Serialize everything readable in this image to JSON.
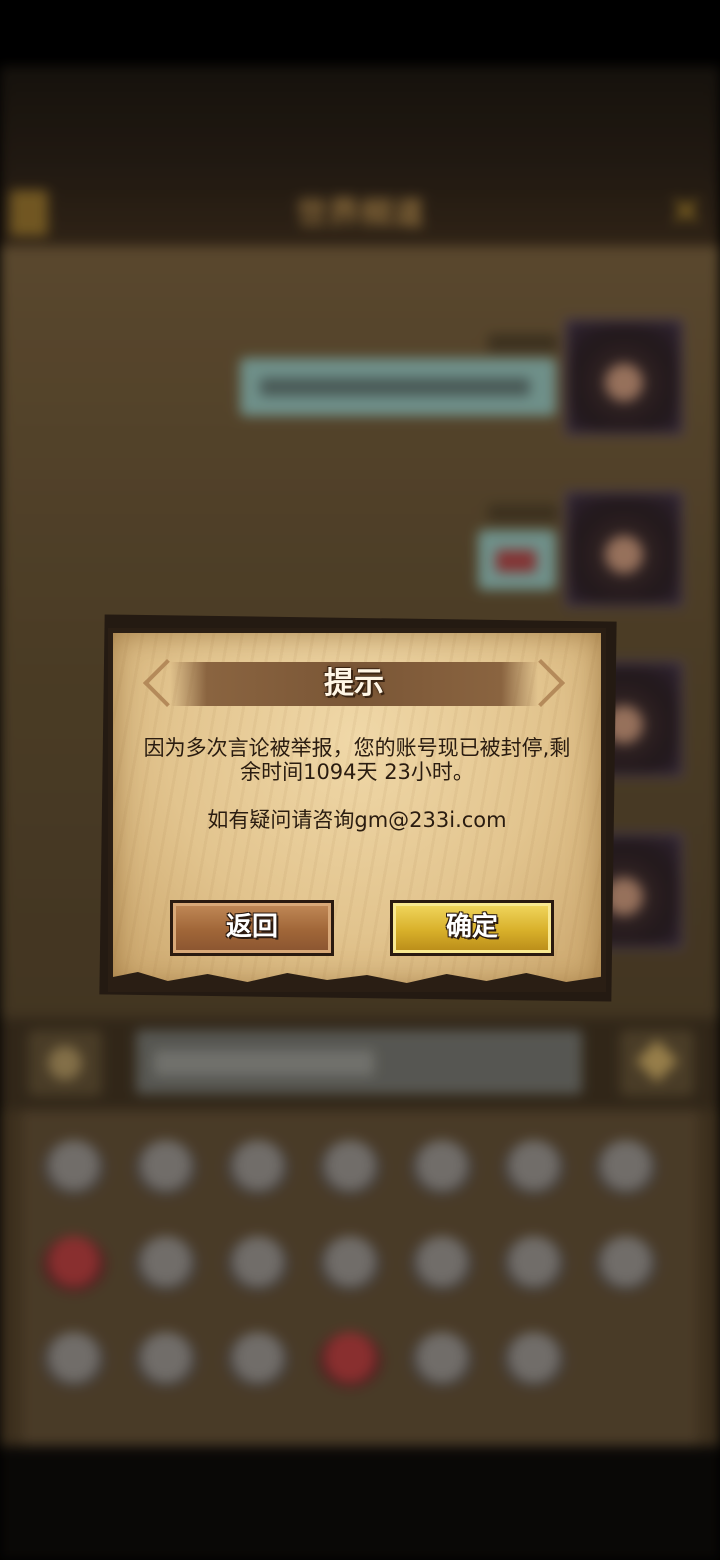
{
  "background": {
    "header_title": "世界频道",
    "input_placeholder": "输入聊天内容"
  },
  "dialog": {
    "title": "提示",
    "message": "因为多次言论被举报，您的账号现已被封停,剩余时间1094天 23小时。",
    "contact": "如有疑问请咨询gm@233i.com",
    "back_label": "返回",
    "confirm_label": "确定"
  },
  "colors": {
    "paper": "#e2c48e",
    "confirm_button": "#d8b02a",
    "back_button": "#a06638",
    "frame": "#2a1e14"
  }
}
